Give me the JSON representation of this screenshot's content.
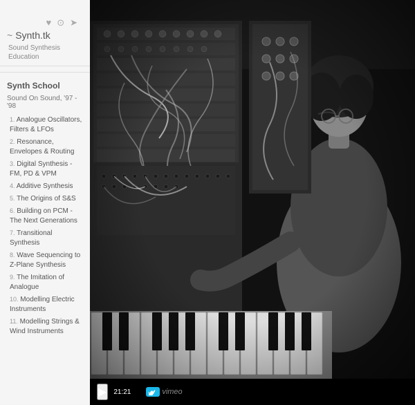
{
  "site": {
    "logo": "Synth.tk",
    "logo_wave": "~",
    "subtitle": "Sound Synthesis Education"
  },
  "header_icons": {
    "heart": "♥",
    "clock": "⊙",
    "share": "➤"
  },
  "sidebar": {
    "section_title": "Synth School",
    "subsection_title": "Sound On Sound, '97 - '98",
    "items": [
      {
        "num": "1.",
        "label": "Analogue Oscillators, Filters & LFOs"
      },
      {
        "num": "2.",
        "label": "Resonance, Envelopes & Routing"
      },
      {
        "num": "3.",
        "label": "Digital Synthesis - FM, PD & VPM"
      },
      {
        "num": "4.",
        "label": "Additive Synthesis"
      },
      {
        "num": "5.",
        "label": "The Origins of S&S"
      },
      {
        "num": "6.",
        "label": "Building on PCM - The Next Generations"
      },
      {
        "num": "7.",
        "label": "Transitional Synthesis"
      },
      {
        "num": "8.",
        "label": "Wave Sequencing to Z-Plane Synthesis"
      },
      {
        "num": "9.",
        "label": "The Imitation of Analogue"
      },
      {
        "num": "10.",
        "label": "Modelling Electric Instruments"
      },
      {
        "num": "11.",
        "label": "Modelling Strings & Wind Instruments"
      }
    ]
  },
  "video": {
    "time": "21:21",
    "provider": "vimeo",
    "play_button": "▶"
  }
}
